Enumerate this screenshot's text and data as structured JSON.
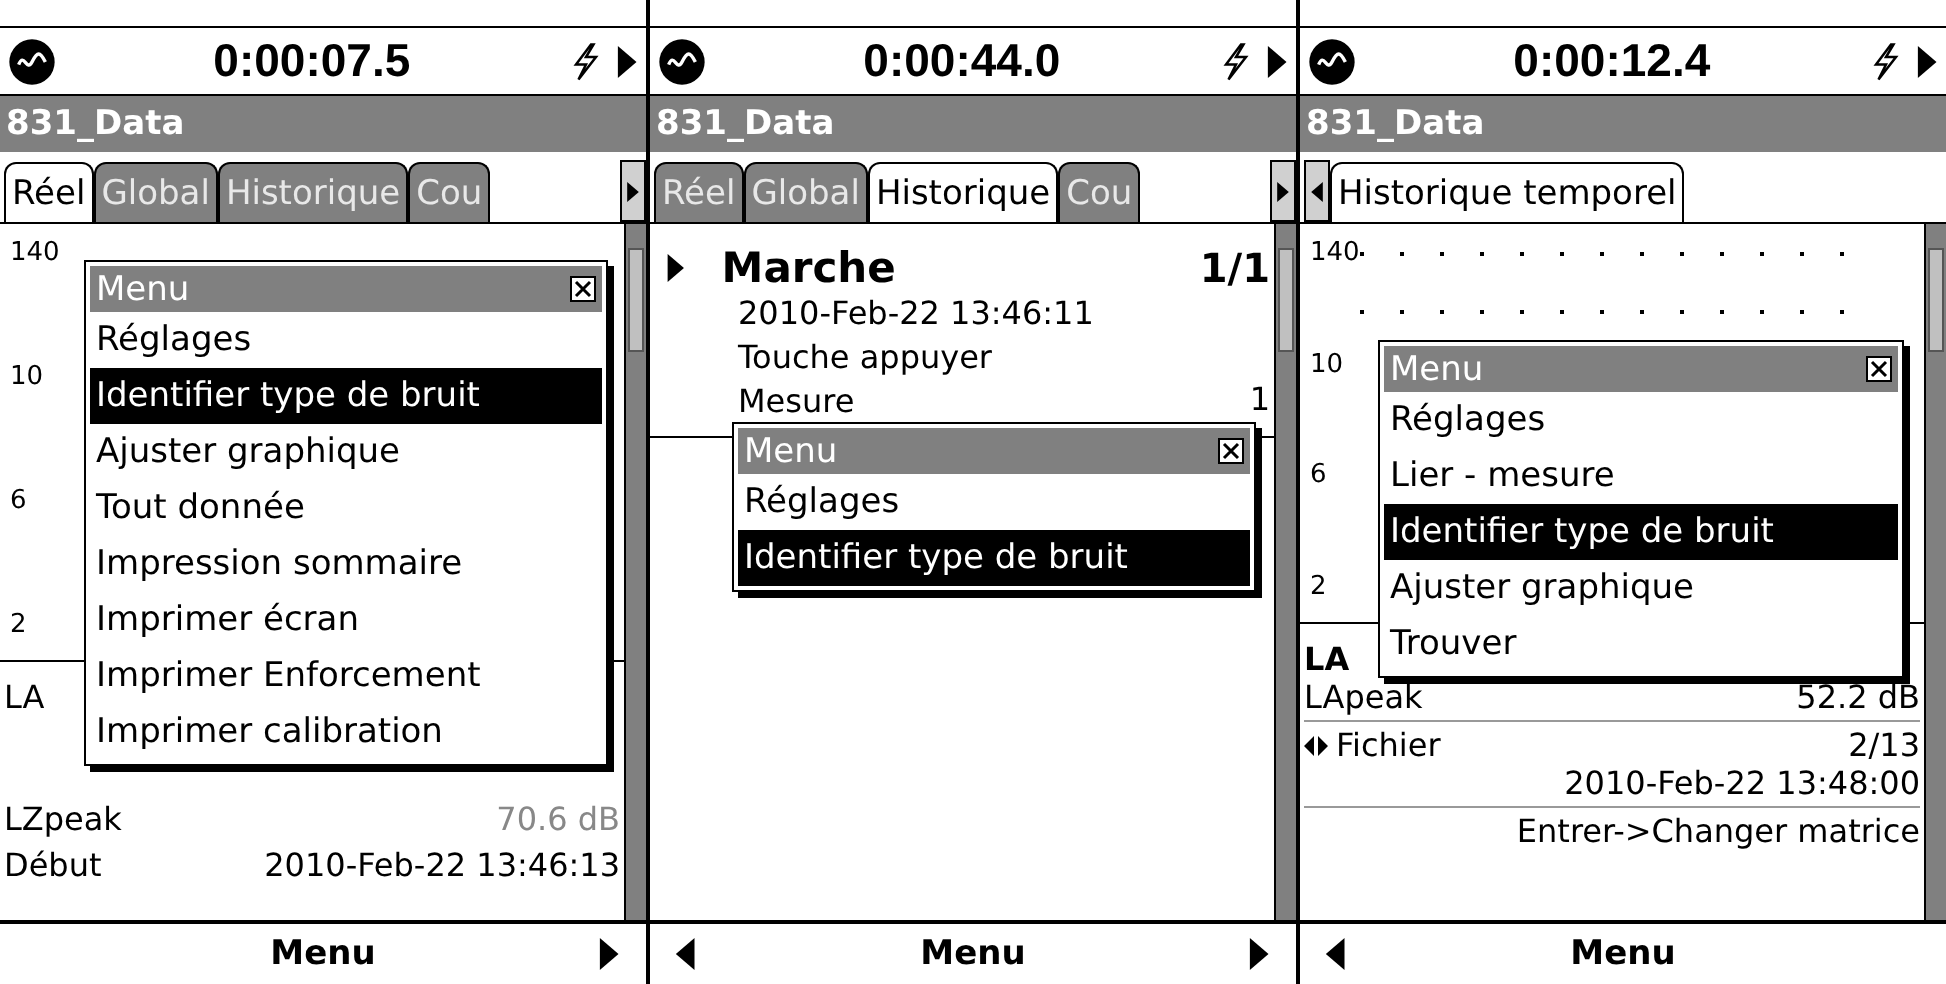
{
  "panels": [
    {
      "time": "0:00:07.5",
      "title": "831_Data",
      "tab_scroll": {
        "left": false,
        "right": true
      },
      "tabs": [
        {
          "label": "Réel",
          "selected": true
        },
        {
          "label": "Global",
          "selected": false
        },
        {
          "label": "Historique",
          "selected": false
        },
        {
          "label": "Cou",
          "selected": false
        }
      ],
      "body": {
        "kind": "chart",
        "grid": false,
        "axis_labels": [
          "140",
          "10",
          "6",
          "2"
        ],
        "readings": [
          {
            "kind": "pair",
            "label": "LA",
            "bold": false
          },
          {
            "kind": "gap"
          },
          {
            "kind": "pair",
            "label": "LZpeak",
            "value": "70.6 dB",
            "dim": true
          },
          {
            "kind": "pair",
            "label": "Début",
            "value": "2010-Feb-22 13:46:13",
            "dim": false
          }
        ]
      },
      "menu": {
        "title": "Menu",
        "items": [
          {
            "label": "Réglages",
            "selected": false
          },
          {
            "label": "Identifier type de bruit",
            "selected": true
          },
          {
            "label": "Ajuster graphique",
            "selected": false
          },
          {
            "label": "Tout donnée",
            "selected": false
          },
          {
            "label": "Impression sommaire",
            "selected": false
          },
          {
            "label": "Imprimer écran",
            "selected": false
          },
          {
            "label": "Imprimer Enforcement",
            "selected": false
          },
          {
            "label": "Imprimer calibration",
            "selected": false
          }
        ]
      },
      "softkey": {
        "label": "Menu",
        "left": false,
        "right": true
      }
    },
    {
      "time": "0:00:44.0",
      "title": "831_Data",
      "tab_scroll": {
        "left": false,
        "right": true
      },
      "tabs": [
        {
          "label": "Réel",
          "selected": false
        },
        {
          "label": "Global",
          "selected": false
        },
        {
          "label": "Historique",
          "selected": true
        },
        {
          "label": "Cou",
          "selected": false
        }
      ],
      "body": {
        "kind": "log",
        "entry": {
          "title": "Marche",
          "count": "1/1",
          "lines": [
            "2010-Feb-22 13:46:11",
            "Touche appuyer"
          ],
          "last_label": "Mesure",
          "last_value": "1"
        }
      },
      "menu": {
        "title": "Menu",
        "items": [
          {
            "label": "Réglages",
            "selected": false
          },
          {
            "label": "Identifier type de bruit",
            "selected": true
          }
        ]
      },
      "softkey": {
        "label": "Menu",
        "left": true,
        "right": true
      }
    },
    {
      "time": "0:00:12.4",
      "title": "831_Data",
      "tab_scroll": {
        "left": true,
        "right": false
      },
      "tabs": [
        {
          "label": "Historique temporel",
          "selected": true
        }
      ],
      "body": {
        "kind": "chart",
        "grid": true,
        "axis_labels": [
          "140",
          "10",
          "6",
          "2"
        ],
        "readings": [
          {
            "kind": "pair",
            "label": "LA",
            "bold": true
          },
          {
            "kind": "pair",
            "label": "LApeak",
            "value": "52.2 dB",
            "dim": false
          },
          {
            "kind": "rule"
          },
          {
            "kind": "file",
            "label": "Fichier",
            "value": "2/13"
          },
          {
            "kind": "note",
            "text": "2010-Feb-22 13:48:00"
          },
          {
            "kind": "rule"
          },
          {
            "kind": "note",
            "text": "Entrer->Changer matrice"
          }
        ]
      },
      "menu": {
        "title": "Menu",
        "items": [
          {
            "label": "Réglages",
            "selected": false
          },
          {
            "label": "Lier - mesure",
            "selected": false
          },
          {
            "label": "Identifier type de bruit",
            "selected": true
          },
          {
            "label": "Ajuster graphique",
            "selected": false
          },
          {
            "label": "Trouver",
            "selected": false
          }
        ]
      },
      "softkey": {
        "label": "Menu",
        "left": true,
        "right": false
      }
    }
  ]
}
